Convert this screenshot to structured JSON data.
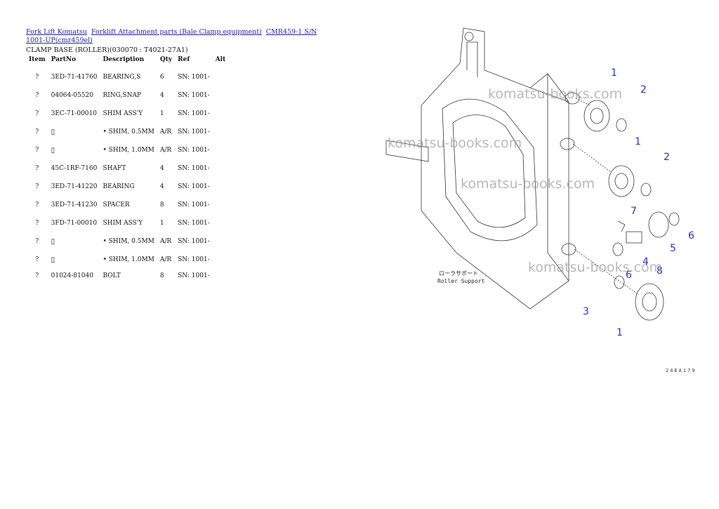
{
  "breadcrumb": {
    "link1": "Fork Lift Komatsu",
    "link2": "Forklift Attachment parts (Bale Clamp equipment)",
    "link3": "CMR459-1 S/N 1001-UP(cmr459el)"
  },
  "title": "CLAMP BASE (ROLLER)(030070 : T4021-27A1)",
  "table": {
    "headers": [
      "Item",
      "PartNo",
      "Description",
      "Qty",
      "Ref",
      "Alt"
    ],
    "rows": [
      {
        "item": "?",
        "part": "3ED-71-41760",
        "desc": "BEARING,S",
        "qty": "6",
        "ref": "SN: 1001-"
      },
      {
        "item": "?",
        "part": "04064-05520",
        "desc": "RING,SNAP",
        "qty": "4",
        "ref": "SN: 1001-"
      },
      {
        "item": "?",
        "part": "3EC-71-00010",
        "desc": "SHIM ASS'Y",
        "qty": "1",
        "ref": "SN: 1001-"
      },
      {
        "item": "?",
        "part": "",
        "desc": "• SHIM, 0.5MM",
        "qty": "A/R",
        "ref": "SN: 1001-"
      },
      {
        "item": "?",
        "part": "",
        "desc": "• SHIM, 1.0MM",
        "qty": "A/R",
        "ref": "SN: 1001-"
      },
      {
        "item": "?",
        "part": "45C-1RF-7160",
        "desc": "SHAFT",
        "qty": "4",
        "ref": "SN: 1001-"
      },
      {
        "item": "?",
        "part": "3ED-71-41220",
        "desc": "BEARING",
        "qty": "4",
        "ref": "SN: 1001-"
      },
      {
        "item": "?",
        "part": "3ED-71-41230",
        "desc": "SPACER",
        "qty": "8",
        "ref": "SN: 1001-"
      },
      {
        "item": "?",
        "part": "3FD-71-00010",
        "desc": "SHIM ASS'Y",
        "qty": "1",
        "ref": "SN: 1001-"
      },
      {
        "item": "?",
        "part": "",
        "desc": "• SHIM, 0.5MM",
        "qty": "A/R",
        "ref": "SN: 1001-"
      },
      {
        "item": "?",
        "part": "",
        "desc": "• SHIM, 1.0MM",
        "qty": "A/R",
        "ref": "SN: 1001-"
      },
      {
        "item": "?",
        "part": "01024-81040",
        "desc": "BOLT",
        "qty": "8",
        "ref": "SN: 1001-"
      }
    ]
  },
  "diagram": {
    "watermark": "komatsu-books.com",
    "caption_jp": "ローラサポート",
    "caption_en": "Roller Support",
    "code": "24EA179",
    "callouts": [
      "1",
      "2",
      "1",
      "2",
      "7",
      "6",
      "5",
      "4",
      "8",
      "6",
      "3",
      "1"
    ],
    "callout_color": "#1c2fc4"
  }
}
